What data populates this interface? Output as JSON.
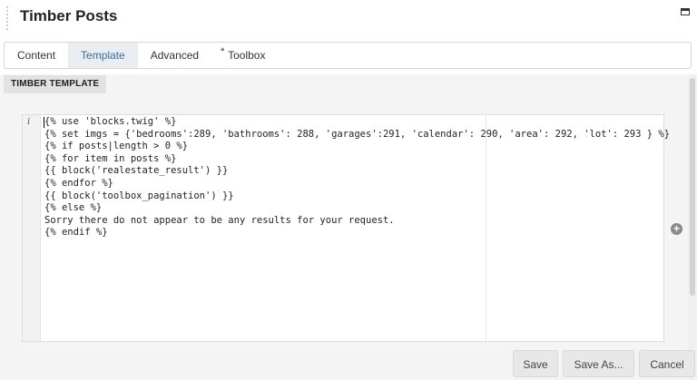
{
  "window": {
    "title": "Timber Posts",
    "maximize_icon": "window-maximize-icon"
  },
  "tabs": [
    {
      "label": "Content",
      "active": false
    },
    {
      "label": "Template",
      "active": true
    },
    {
      "label": "Advanced",
      "active": false
    },
    {
      "label": "Toolbox",
      "active": false,
      "modified_marker": "*"
    }
  ],
  "section": {
    "label": "TIMBER TEMPLATE"
  },
  "editor": {
    "gutter_marker": "i",
    "lines": [
      "{% use 'blocks.twig' %}",
      "{% set imgs = {'bedrooms':289, 'bathrooms': 288, 'garages':291, 'calendar': 290, 'area': 292, 'lot': 293 } %}",
      "{% if posts|length > 0 %}",
      "{% for item in posts %}",
      "{{ block('realestate_result') }}",
      "{% endfor %}",
      "{{ block('toolbox_pagination') }}",
      "{% else %}",
      "Sorry there do not appear to be any results for your request.",
      "{% endif %}"
    ]
  },
  "buttons": {
    "save": "Save",
    "save_as": "Save As...",
    "cancel": "Cancel"
  },
  "colors": {
    "active_tab_bg": "#e9eef2",
    "active_tab_text": "#3a6c98"
  }
}
